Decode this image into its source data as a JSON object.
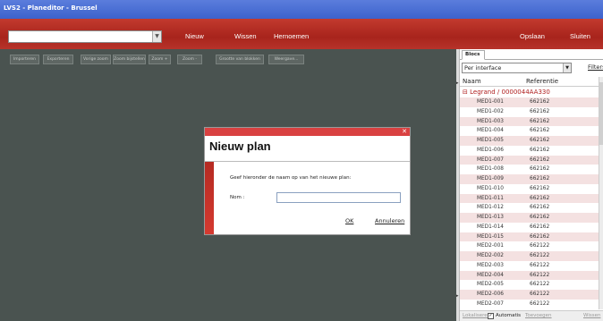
{
  "app": {
    "title": "LVS2 - Planeditor - Brussel"
  },
  "topbar": {
    "plan_select_value": "",
    "new_label": "Nieuw",
    "delete_label": "Wissen",
    "rename_label": "Hernoemen",
    "save_label": "Opslaan",
    "close_label": "Sluiten"
  },
  "toolbar": {
    "buttons": [
      "Importeren",
      "Exporteren",
      "Vorige zoom",
      "Zoom bijstellen",
      "Zoom +",
      "Zoom -",
      "Grootte van blokken",
      "Weergave..."
    ]
  },
  "panel": {
    "tab_label": "Blocs",
    "filter_select_value": "Per interface",
    "filter_link": "Filters",
    "col_name": "Naam",
    "col_ref": "Referentie",
    "group_label": "Legrand / 0000044AA330",
    "rows": [
      {
        "name": "MED1-001",
        "ref": "662162"
      },
      {
        "name": "MED1-002",
        "ref": "662162"
      },
      {
        "name": "MED1-003",
        "ref": "662162"
      },
      {
        "name": "MED1-004",
        "ref": "662162"
      },
      {
        "name": "MED1-005",
        "ref": "662162"
      },
      {
        "name": "MED1-006",
        "ref": "662162"
      },
      {
        "name": "MED1-007",
        "ref": "662162"
      },
      {
        "name": "MED1-008",
        "ref": "662162"
      },
      {
        "name": "MED1-009",
        "ref": "662162"
      },
      {
        "name": "MED1-010",
        "ref": "662162"
      },
      {
        "name": "MED1-011",
        "ref": "662162"
      },
      {
        "name": "MED1-012",
        "ref": "662162"
      },
      {
        "name": "MED1-013",
        "ref": "662162"
      },
      {
        "name": "MED1-014",
        "ref": "662162"
      },
      {
        "name": "MED1-015",
        "ref": "662162"
      },
      {
        "name": "MED2-001",
        "ref": "662122"
      },
      {
        "name": "MED2-002",
        "ref": "662122"
      },
      {
        "name": "MED2-003",
        "ref": "662122"
      },
      {
        "name": "MED2-004",
        "ref": "662122"
      },
      {
        "name": "MED2-005",
        "ref": "662122"
      },
      {
        "name": "MED2-006",
        "ref": "662122"
      },
      {
        "name": "MED2-007",
        "ref": "662122"
      }
    ],
    "footer": {
      "locate_label": "Lokaliseren",
      "auto_label": "Automatis",
      "add_label": "Toevoegen",
      "delete_label": "Wissen"
    }
  },
  "dialog": {
    "title": "Nieuw plan",
    "message": "Geef hieronder de naam op van het nieuwe plan:",
    "name_label": "Nom :",
    "name_value": "",
    "ok_label": "OK",
    "cancel_label": "Annuleren"
  }
}
